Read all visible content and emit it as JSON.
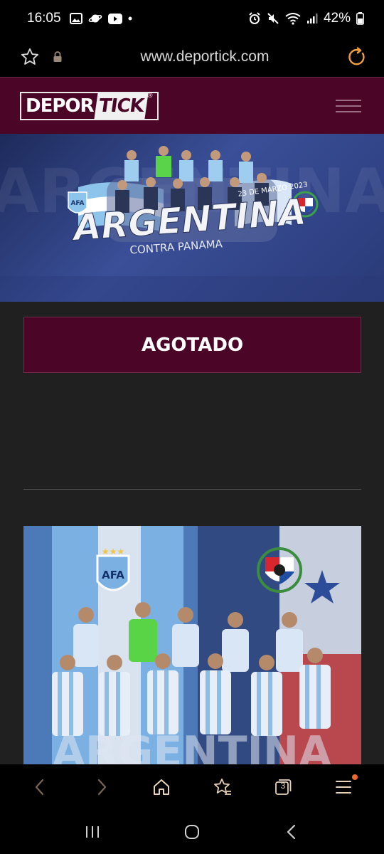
{
  "status_bar": {
    "time": "16:05",
    "battery_percent": "42%"
  },
  "browser": {
    "url": "www.deportick.com",
    "tab_count": "3"
  },
  "site": {
    "logo_part1": "DEPOR",
    "logo_part2": "TICK",
    "logo_reg": "®"
  },
  "banner": {
    "title": "ARGENTINA",
    "subtitle": "CONTRA PANAMA",
    "date": "23 DE MARZO 2023"
  },
  "event": {
    "status_button": "AGOTADO"
  },
  "poster": {
    "title": "ARGENTINA"
  },
  "colors": {
    "brand": "#4a0527",
    "accent_orange": "#f08a2c",
    "background": "#202020"
  }
}
